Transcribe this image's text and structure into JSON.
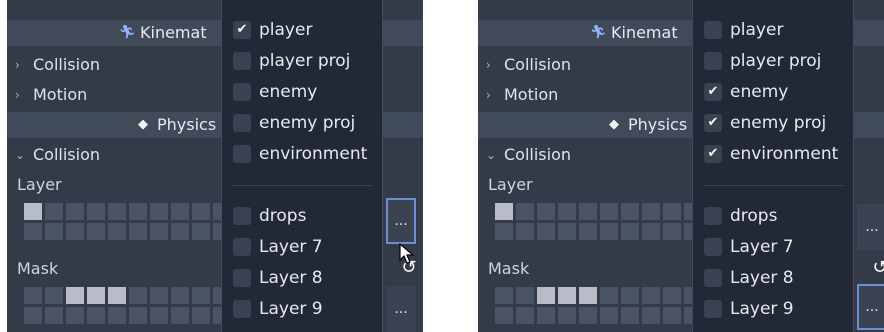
{
  "panels": [
    {
      "kinematic_header": "Kinemat",
      "collision_row": "Collision",
      "motion_row": "Motion",
      "physics_header": "Physics",
      "collision_expanded_row": "Collision",
      "layer_label": "Layer",
      "mask_label": "Mask",
      "dots": "...",
      "menu": [
        {
          "label": "player",
          "checked": "✔"
        },
        {
          "label": "player proj",
          "checked": ""
        },
        {
          "label": "enemy",
          "checked": ""
        },
        {
          "label": "enemy proj",
          "checked": ""
        },
        {
          "label": "environment",
          "checked": ""
        },
        {
          "label": "drops",
          "checked": ""
        },
        {
          "label": "Layer 7",
          "checked": ""
        },
        {
          "label": "Layer 8",
          "checked": ""
        },
        {
          "label": "Layer 9",
          "checked": ""
        }
      ]
    },
    {
      "kinematic_header": "Kinemat",
      "collision_row": "Collision",
      "motion_row": "Motion",
      "physics_header": "Physics",
      "collision_expanded_row": "Collision",
      "layer_label": "Layer",
      "mask_label": "Mask",
      "dots": "...",
      "menu": [
        {
          "label": "player",
          "checked": ""
        },
        {
          "label": "player proj",
          "checked": ""
        },
        {
          "label": "enemy",
          "checked": "✔"
        },
        {
          "label": "enemy proj",
          "checked": "✔"
        },
        {
          "label": "environment",
          "checked": "✔"
        },
        {
          "label": "drops",
          "checked": ""
        },
        {
          "label": "Layer 7",
          "checked": ""
        },
        {
          "label": "Layer 8",
          "checked": ""
        },
        {
          "label": "Layer 9",
          "checked": ""
        }
      ]
    }
  ],
  "icons": {
    "chevron_right": "›",
    "chevron_down": "⌄",
    "kinematic": "kinematic-body-icon",
    "physics": "physics-cube-icon",
    "revert": "revert-icon"
  },
  "grid_state": {
    "layer_on_bits": [
      1
    ],
    "mask_on_bits": [
      3,
      4,
      5
    ]
  },
  "colors": {
    "panel_bg": "#343b48",
    "popup_bg": "#222836",
    "cell_off": "#4a5363",
    "cell_on": "#b7bcc6",
    "accent": "#6b8fd6"
  }
}
